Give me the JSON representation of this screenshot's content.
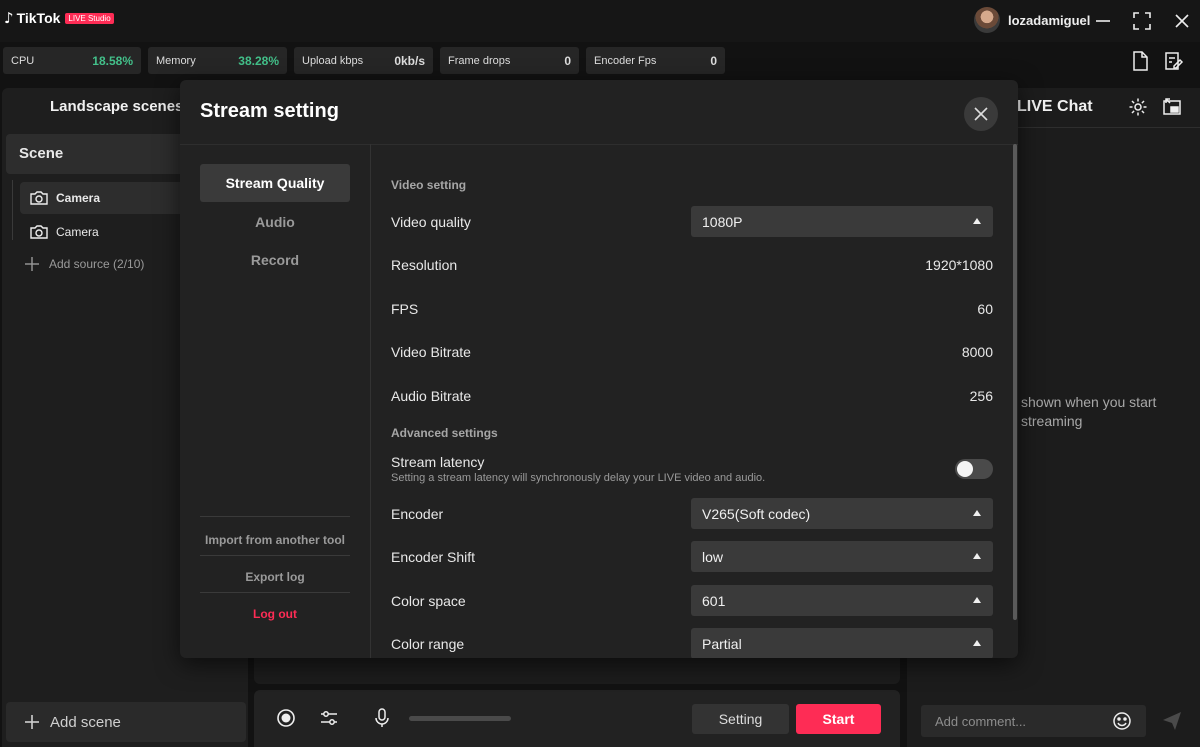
{
  "app": {
    "logo_text": "TikTok",
    "logo_badge": "LIVE Studio"
  },
  "user": {
    "name": "lozadamiguel"
  },
  "stats": [
    {
      "label": "CPU",
      "value": "18.58%",
      "color": "#43c08a"
    },
    {
      "label": "Memory",
      "value": "38.28%",
      "color": "#43c08a"
    },
    {
      "label": "Upload kbps",
      "value": "0kb/s",
      "color": "#ffffff"
    },
    {
      "label": "Frame drops",
      "value": "0",
      "color": "#ffffff"
    },
    {
      "label": "Encoder Fps",
      "value": "0",
      "color": "#ffffff"
    }
  ],
  "left_panel": {
    "title": "Landscape scenes",
    "scene_label": "Scene",
    "sources": [
      {
        "label": "Camera",
        "icon": "camera-icon",
        "active": true
      },
      {
        "label": "Camera",
        "icon": "camera-icon",
        "active": false
      }
    ],
    "add_source": "Add source (2/10)",
    "add_scene": "Add scene"
  },
  "bottom_bar": {
    "setting_label": "Setting",
    "start_label": "Start"
  },
  "chat": {
    "title": "LIVE Chat",
    "empty_line1": "shown when you start",
    "empty_line2": "streaming",
    "comment_placeholder": "Add comment..."
  },
  "modal": {
    "title": "Stream setting",
    "nav": [
      "Stream Quality",
      "Audio",
      "Record"
    ],
    "nav_links": {
      "import": "Import from another tool",
      "export": "Export log",
      "logout": "Log out"
    },
    "sections": {
      "video": "Video setting",
      "advanced": "Advanced settings"
    },
    "video_quality": {
      "label": "Video quality",
      "value": "1080P"
    },
    "resolution": {
      "label": "Resolution",
      "value": "1920*1080"
    },
    "fps": {
      "label": "FPS",
      "value": "60"
    },
    "video_bitrate": {
      "label": "Video Bitrate",
      "value": "8000"
    },
    "audio_bitrate": {
      "label": "Audio Bitrate",
      "value": "256"
    },
    "stream_latency": {
      "label": "Stream latency",
      "hint": "Setting a stream latency will synchronously delay your LIVE video and audio.",
      "enabled": false
    },
    "encoder": {
      "label": "Encoder",
      "value": "V265(Soft codec)"
    },
    "encoder_shift": {
      "label": "Encoder Shift",
      "value": "low"
    },
    "color_space": {
      "label": "Color space",
      "value": "601"
    },
    "color_range": {
      "label": "Color range",
      "value": "Partial"
    }
  },
  "colors": {
    "accent": "#fe2c55",
    "positive": "#43c08a"
  }
}
